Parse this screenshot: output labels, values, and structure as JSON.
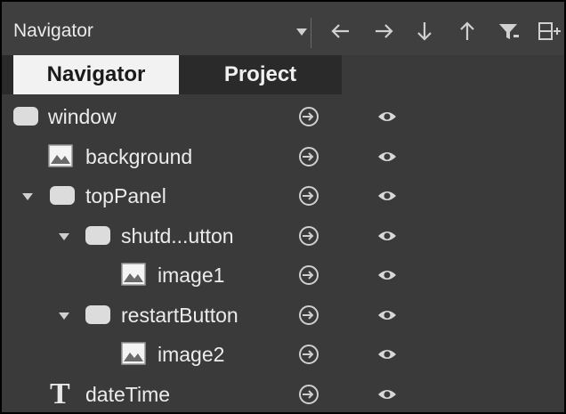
{
  "toolbar": {
    "combo_label": "Navigator",
    "buttons": [
      {
        "name": "arrow-left-icon",
        "glyph": "←"
      },
      {
        "name": "arrow-right-icon",
        "glyph": "→"
      },
      {
        "name": "arrow-down-icon",
        "glyph": "↓"
      },
      {
        "name": "arrow-up-icon",
        "glyph": "↑"
      },
      {
        "name": "filter-icon",
        "glyph": "filter"
      },
      {
        "name": "add-layout-icon",
        "glyph": "layout-add"
      }
    ]
  },
  "tabs": [
    {
      "label": "Navigator",
      "active": true
    },
    {
      "label": "Project",
      "active": false
    }
  ],
  "tree": {
    "items": [
      {
        "label": "window",
        "icon": "item-icon",
        "expandable": false
      },
      {
        "label": "background",
        "icon": "image-icon",
        "expandable": false
      },
      {
        "label": "topPanel",
        "icon": "item-icon",
        "expandable": true
      },
      {
        "label": "shutd...utton",
        "icon": "item-icon",
        "expandable": true
      },
      {
        "label": "image1",
        "icon": "image-icon",
        "expandable": false
      },
      {
        "label": "restartButton",
        "icon": "item-icon",
        "expandable": true
      },
      {
        "label": "image2",
        "icon": "image-icon",
        "expandable": false
      },
      {
        "label": "dateTime",
        "icon": "text-icon",
        "expandable": false
      }
    ]
  },
  "colors": {
    "background": "#3a3a3a",
    "toolbar": "#3f3f3f",
    "active_tab": "#f2f2f2",
    "text": "#ececec",
    "icon": "#dcdcdc"
  }
}
